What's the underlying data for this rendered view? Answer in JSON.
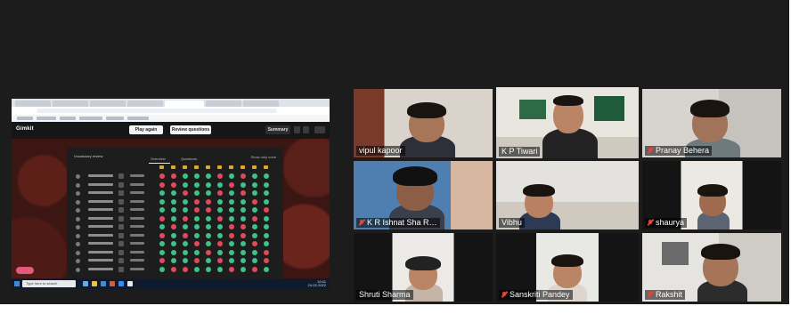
{
  "screen_share": {
    "app_logo": "Gimkit",
    "buttons": {
      "play_again": "Play again",
      "review": "Review questions",
      "summary": "Summary"
    },
    "board_title": "Vocabulary review",
    "tabs": [
      "Overview",
      "Questions"
    ],
    "filter_label": "Show only none",
    "taskbar": {
      "search_placeholder": "Type here to search",
      "time": "10:41",
      "date": "24-02-2022"
    },
    "correct_color": "#3fc28a",
    "wrong_color": "#e04a5a"
  },
  "participants": [
    {
      "name": "vipul kapoor",
      "muted": false,
      "active": false
    },
    {
      "name": "K P Tiwari",
      "muted": false,
      "active": true
    },
    {
      "name": "Pranay Behera",
      "muted": true,
      "active": false
    },
    {
      "name": "K R Ishnat Sha R…",
      "muted": true,
      "active": false
    },
    {
      "name": "Vibhu",
      "muted": false,
      "active": false
    },
    {
      "name": "shaurya",
      "muted": true,
      "active": false
    },
    {
      "name": "Shruti Sharma",
      "muted": false,
      "active": false
    },
    {
      "name": "Sanskriti Pandey",
      "muted": true,
      "active": false
    },
    {
      "name": "Rakshit",
      "muted": true,
      "active": false
    }
  ]
}
